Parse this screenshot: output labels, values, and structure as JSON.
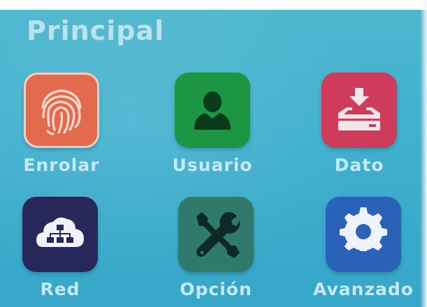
{
  "screen": {
    "title": "Principal"
  },
  "menu": {
    "items": [
      {
        "id": "enrolar",
        "label": "Enrolar",
        "icon": "fingerprint-icon",
        "color": "#e46a4d"
      },
      {
        "id": "usuario",
        "label": "Usuario",
        "icon": "user-icon",
        "color": "#1d9644"
      },
      {
        "id": "dato",
        "label": "Dato",
        "icon": "data-tray-icon",
        "color": "#cf3b5a"
      },
      {
        "id": "red",
        "label": "Red",
        "icon": "cloud-network-icon",
        "color": "#27275a"
      },
      {
        "id": "opcion",
        "label": "Opción",
        "icon": "tools-icon",
        "color": "#2f7a6d"
      },
      {
        "id": "avanzado",
        "label": "Avanzado",
        "icon": "gear-icon",
        "color": "#2a62b8"
      }
    ]
  },
  "theme": {
    "background": "#3fb0ce",
    "label_color": "#c6e8f0"
  }
}
